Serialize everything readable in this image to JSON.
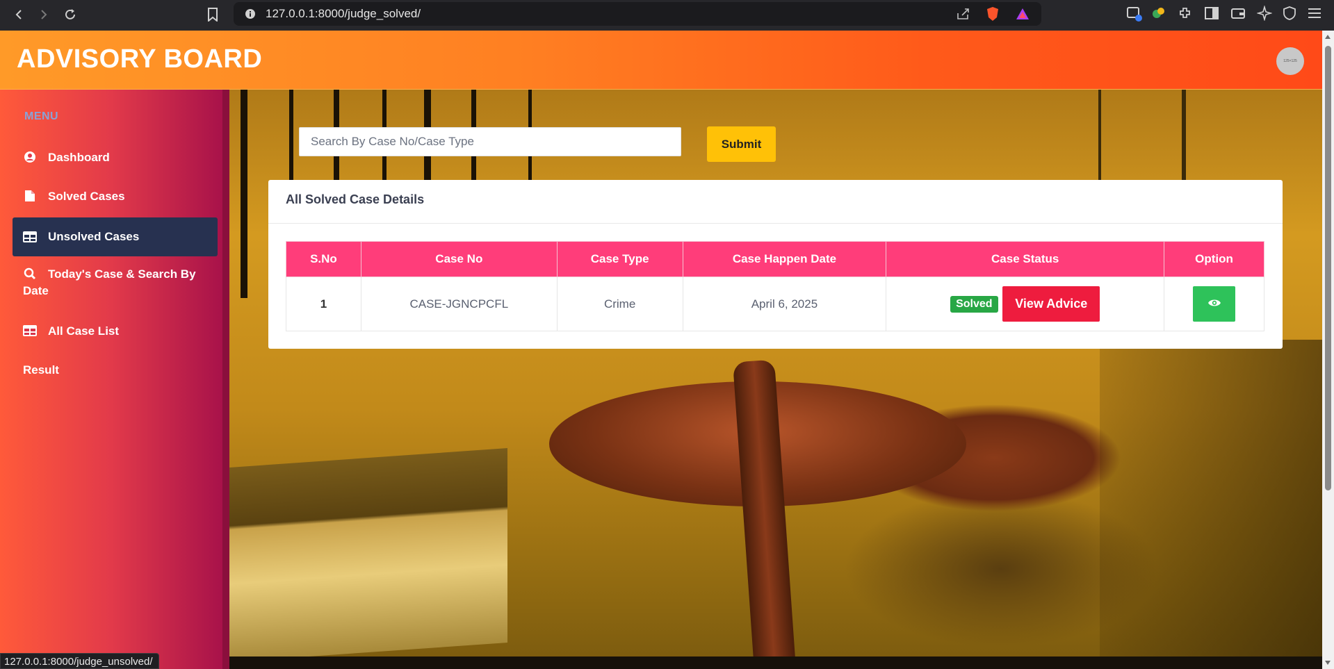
{
  "browser": {
    "url": "127.0.0.1:8000/judge_solved/",
    "status_url": "127.0.0.1:8000/judge_unsolved/"
  },
  "header": {
    "brand": "ADVISORY BOARD",
    "avatar_text": "125×125"
  },
  "sidebar": {
    "menu_title": "MENU",
    "items": [
      {
        "label": "Dashboard",
        "icon": "user-circle-icon"
      },
      {
        "label": "Solved Cases",
        "icon": "file-icon"
      },
      {
        "label": "Unsolved Cases",
        "icon": "table-icon",
        "active": true
      },
      {
        "label": "Today's Case & Search By Date",
        "icon": "search-icon"
      },
      {
        "label": "All Case List",
        "icon": "table-icon"
      },
      {
        "label": "Result",
        "icon": ""
      }
    ]
  },
  "search": {
    "placeholder": "Search By Case No/Case Type",
    "submit_label": "Submit"
  },
  "card": {
    "title": "All Solved Case Details"
  },
  "table": {
    "headers": [
      "S.No",
      "Case No",
      "Case Type",
      "Case Happen Date",
      "Case Status",
      "Option"
    ],
    "rows": [
      {
        "sno": "1",
        "case_no": "CASE-JGNCPCFL",
        "case_type": "Crime",
        "date": "April 6, 2025",
        "status": "Solved",
        "action": "View Advice"
      }
    ]
  },
  "colors": {
    "accent_pink": "#ff3d7a",
    "submit_yellow": "#ffc107",
    "solved_green": "#28a745",
    "view_advice_red": "#ee1c3e",
    "option_green": "#2ec25a",
    "sidebar_active": "#273150"
  }
}
